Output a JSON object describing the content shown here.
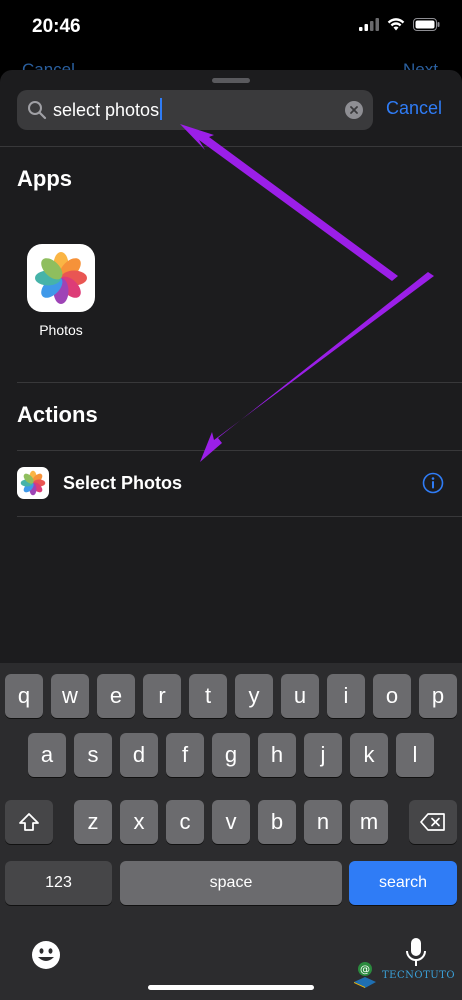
{
  "status_bar": {
    "time": "20:46"
  },
  "underlying": {
    "cancel_label": "Cancel",
    "next_label": "Next"
  },
  "search": {
    "value": "select photos",
    "cancel_label": "Cancel"
  },
  "sections": {
    "apps_title": "Apps",
    "actions_title": "Actions"
  },
  "apps": [
    {
      "label": "Photos",
      "icon": "photos-icon"
    }
  ],
  "actions": [
    {
      "label": "Select Photos",
      "icon": "photos-icon",
      "info_icon": "info-icon"
    }
  ],
  "keyboard": {
    "row1": [
      "q",
      "w",
      "e",
      "r",
      "t",
      "y",
      "u",
      "i",
      "o",
      "p"
    ],
    "row2": [
      "a",
      "s",
      "d",
      "f",
      "g",
      "h",
      "j",
      "k",
      "l"
    ],
    "row3": [
      "z",
      "x",
      "c",
      "v",
      "b",
      "n",
      "m"
    ],
    "numbers_label": "123",
    "space_label": "space",
    "search_label": "search"
  },
  "watermark": {
    "text": "TECNOTUTO"
  },
  "colors": {
    "accent": "#2f7cf6",
    "annotation": "#9b1fe8",
    "sheet": "#1c1c1e",
    "keyboard": "#2c2c2e"
  }
}
